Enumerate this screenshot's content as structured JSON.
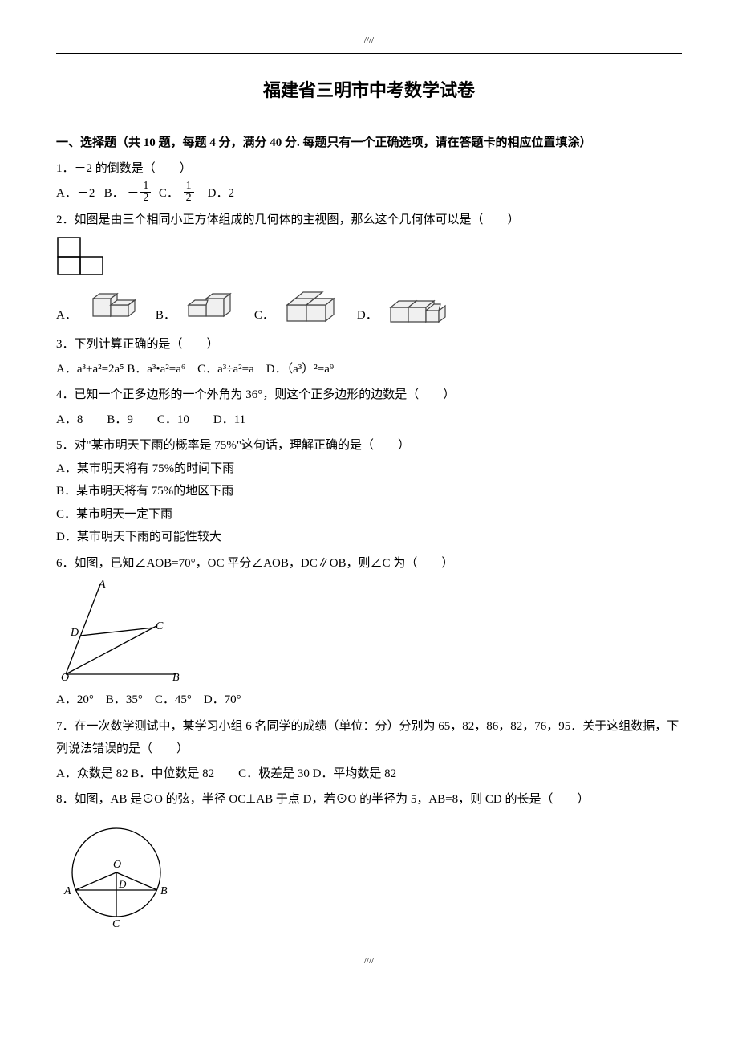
{
  "header_mark": "////",
  "title": "福建省三明市中考数学试卷",
  "section1_heading": "一、选择题（共 10 题，每题 4 分，满分 40 分. 每题只有一个正确选项，请在答题卡的相应位置填涂）",
  "q1": {
    "text": "1．－2 的倒数是（　　）",
    "A": "A．－2",
    "B": "B．",
    "C": "C．",
    "D": "D．2"
  },
  "frac_neg_half": {
    "num": "1",
    "den": "2"
  },
  "frac_half": {
    "num": "1",
    "den": "2"
  },
  "q2": {
    "text": "2．如图是由三个相同小正方体组成的几何体的主视图，那么这个几何体可以是（　　）"
  },
  "labels": {
    "A": "A．",
    "B": "B．",
    "C": "C．",
    "D": "D．"
  },
  "q3": {
    "text": "3．下列计算正确的是（　　）",
    "optsLine": "A．a³+a²=2a⁵ B．a³•a²=a⁶　C．a³÷a²=a　D．（a³）²=a⁹"
  },
  "q4": {
    "text": "4．已知一个正多边形的一个外角为 36°，则这个正多边形的边数是（　　）",
    "optsLine": "A．8　　B．9　　C．10　　D．11"
  },
  "q5": {
    "text": "5．对\"某市明天下雨的概率是 75%\"这句话，理解正确的是（　　）",
    "A": "A．某市明天将有 75%的时间下雨",
    "B": "B．某市明天将有 75%的地区下雨",
    "C": "C．某市明天一定下雨",
    "D": "D．某市明天下雨的可能性较大"
  },
  "q6": {
    "text": "6．如图，已知∠AOB=70°，OC 平分∠AOB，DC∥OB，则∠C 为（　　）",
    "optsLine": "A．20°　B．35°　C．45°　D．70°"
  },
  "q7": {
    "text": "7．在一次数学测试中，某学习小组 6 名同学的成绩（单位：分）分别为 65，82，86，82，76，95．关于这组数据，下列说法错误的是（　　）",
    "optsLine": "A．众数是 82 B．中位数是 82　　C．极差是 30 D．平均数是 82"
  },
  "q8": {
    "text": "8．如图，AB 是⊙O 的弦，半径 OC⊥AB 于点 D，若⊙O 的半径为 5，AB=8，则 CD 的长是（　　）"
  },
  "footer_mark": "////"
}
